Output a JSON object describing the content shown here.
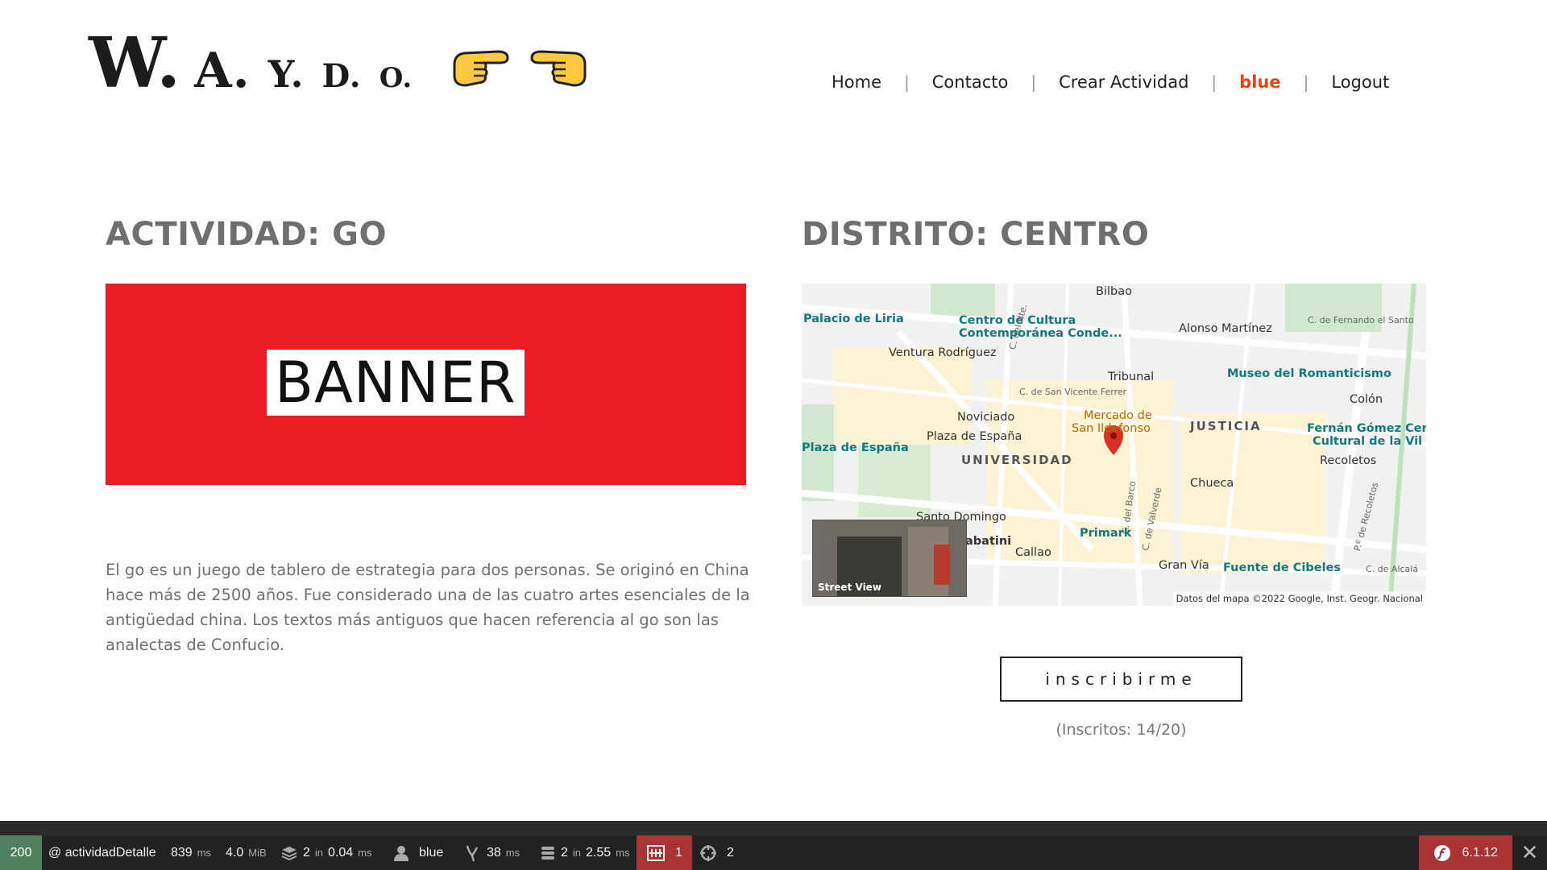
{
  "header": {
    "logo": {
      "w": "W.",
      "a": "A.",
      "y": "Y.",
      "d": "D.",
      "o": "O."
    },
    "nav": [
      {
        "label": "Home"
      },
      {
        "label": "Contacto"
      },
      {
        "label": "Crear Actividad"
      },
      {
        "label": "blue"
      },
      {
        "label": "Logout"
      }
    ],
    "separator": "|"
  },
  "activity": {
    "title": "ACTIVIDAD: GO",
    "banner_text": "BANNER",
    "description": "El go es un juego de tablero de estrategia para dos personas. Se originó en China hace más de 2500 años. Fue considerado una de las cuatro artes esenciales de la antigüedad china. Los textos más antiguos que hacen referencia al go son las analectas de Confucio."
  },
  "district": {
    "title": "DISTRITO: CENTRO"
  },
  "map": {
    "places": {
      "bilbao": "Bilbao",
      "palacio_liria": "Palacio de Liria",
      "centro_cultura": "Centro de Cultura",
      "centro_cultura_2": "Contemporánea Conde...",
      "alonso_martinez": "Alonso Martínez",
      "fernando_santo": "C. de Fernando el Santo",
      "ventura": "Ventura Rodríguez",
      "tribunal": "Tribunal",
      "museo_romanticismo": "Museo del Romanticismo",
      "colon": "Colón",
      "noviciado": "Noviciado",
      "mercado": "Mercado de",
      "mercado_2": "San Ildefonso",
      "justicia": "JUSTICIA",
      "fernan_gomez": "Fernán Gómez Cent",
      "fernan_gomez_2": "Cultural de la Vil",
      "plaza_espana_1": "Plaza de España",
      "plaza_espana_2": "Plaza de España",
      "universidad": "UNIVERSIDAD",
      "recoletos": "Recoletos",
      "chueca": "Chueca",
      "santo_domingo": "Santo Domingo",
      "abatini": "abatini",
      "primark": "Primark",
      "callao": "Callao",
      "gran_via": "Gran Vía",
      "cibeles": "Fuente de Cibeles",
      "alcala": "C. de Alcalá",
      "san_vicente": "C. de San Vicente Ferrer",
      "del_nte": "C. del Nte.",
      "del_barco": "C. del Barco",
      "valverde": "C. de Valverde",
      "recoletos_st": "P.º de Recoletos"
    },
    "street_view_label": "Street View",
    "credit": "Datos del mapa ©2022 Google, Inst. Geogr. Nacional"
  },
  "enroll": {
    "button_label": "inscribirme",
    "count_text": "(Inscritos: 14/20)"
  },
  "toolbar": {
    "status": "200",
    "route": "@ actividadDetalle",
    "time": "839",
    "time_unit": "ms",
    "memory": "4.0",
    "memory_unit": "MiB",
    "forms": "2",
    "forms_in": "in",
    "forms_time": "0.04",
    "forms_unit": "ms",
    "user": "blue",
    "twig_time": "38",
    "twig_unit": "ms",
    "db_queries": "2",
    "db_in": "in",
    "db_time": "2.55",
    "db_unit": "ms",
    "errors": "1",
    "translations": "2",
    "version": "6.1.12"
  },
  "colors": {
    "accent_user": "#e84118",
    "banner_bg": "#ec1c24",
    "toolbar_bg": "#222222",
    "status_ok": "#4f805d",
    "toolbar_alert": "#aa3333"
  }
}
